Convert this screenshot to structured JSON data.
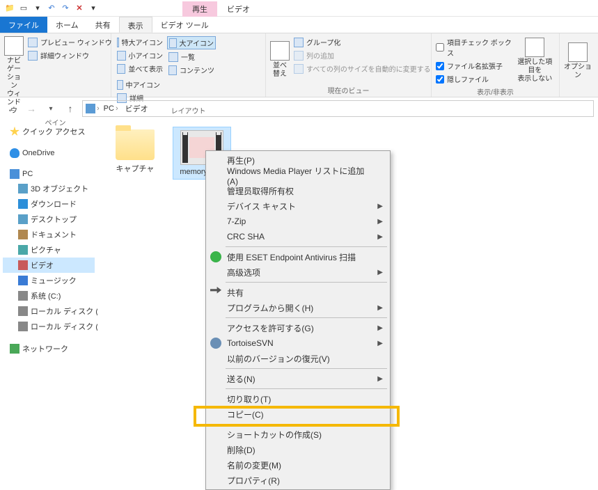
{
  "context_tabs": {
    "playback": "再生",
    "video": "ビデオ"
  },
  "tabs": {
    "file": "ファイル",
    "home": "ホーム",
    "share": "共有",
    "view": "表示",
    "videotools": "ビデオ ツール"
  },
  "ribbon": {
    "pane": {
      "nav": "ナビゲーション\nウィンドウ",
      "preview": "プレビュー ウィンドウ",
      "details": "詳細ウィンドウ",
      "label": "ペイン"
    },
    "layout": {
      "xl": "特大アイコン",
      "l": "大アイコン",
      "m": "中アイコン",
      "s": "小アイコン",
      "list": "一覧",
      "det": "詳細",
      "tile": "並べて表示",
      "content": "コンテンツ",
      "label": "レイアウト"
    },
    "currentview": {
      "sort": "並べ替え",
      "group": "グループ化",
      "addcol": "列の追加",
      "fitcols": "すべての列のサイズを自動的に変更する",
      "label": "現在のビュー"
    },
    "showhide": {
      "chk1": "項目チェック ボックス",
      "chk2": "ファイル名拡張子",
      "chk3": "隠しファイル",
      "hidebtn": "選択した項目を\n表示しない",
      "label": "表示/非表示"
    },
    "options": "オプション"
  },
  "breadcrumb": {
    "pc": "PC",
    "video": "ビデオ"
  },
  "tree": {
    "quick": "クイック アクセス",
    "onedrive": "OneDrive",
    "pc": "PC",
    "obj3d": "3D オブジェクト",
    "dl": "ダウンロード",
    "desk": "デスクトップ",
    "doc": "ドキュメント",
    "pic": "ピクチャ",
    "vid": "ビデオ",
    "mus": "ミュージック",
    "sysdrv": "系统 (C:)",
    "drvd": "ローカル ディスク (D:)",
    "drve": "ローカル ディスク (E:)",
    "net": "ネットワーク"
  },
  "files": {
    "folder1": "キャプチャ",
    "video1": "memory.mp4"
  },
  "menu": {
    "play": "再生(P)",
    "wmp": "Windows Media Player リストに追加(A)",
    "admin": "管理员取得所有权",
    "cast": "デバイス キャスト",
    "sevenzip": "7-Zip",
    "crc": "CRC SHA",
    "eset": "使用 ESET Endpoint Antivirus 扫描",
    "adv": "高级选项",
    "share": "共有",
    "openwith": "プログラムから開く(H)",
    "access": "アクセスを許可する(G)",
    "svn": "TortoiseSVN",
    "restore": "以前のバージョンの復元(V)",
    "send": "送る(N)",
    "cut": "切り取り(T)",
    "copy": "コピー(C)",
    "shortcut": "ショートカットの作成(S)",
    "delete": "削除(D)",
    "rename": "名前の変更(M)",
    "props": "プロパティ(R)"
  }
}
